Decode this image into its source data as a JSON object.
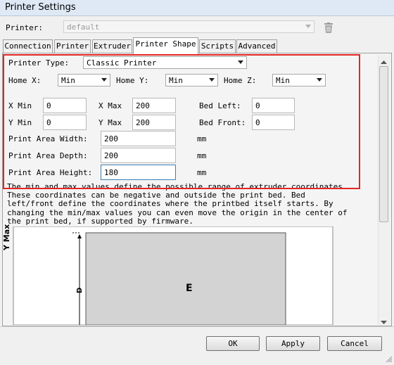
{
  "window": {
    "title": "Printer Settings"
  },
  "printer": {
    "label": "Printer:",
    "value": "default"
  },
  "tabs": [
    {
      "label": "Connection"
    },
    {
      "label": "Printer"
    },
    {
      "label": "Extruder"
    },
    {
      "label": "Printer Shape"
    },
    {
      "label": "Scripts"
    },
    {
      "label": "Advanced"
    }
  ],
  "active_tab": "Printer Shape",
  "shape": {
    "printer_type": {
      "label": "Printer Type:",
      "value": "Classic Printer"
    },
    "home_x": {
      "label": "Home X:",
      "value": "Min"
    },
    "home_y": {
      "label": "Home Y:",
      "value": "Min"
    },
    "home_z": {
      "label": "Home Z:",
      "value": "Min"
    },
    "x_min": {
      "label": "X Min",
      "value": "0"
    },
    "x_max": {
      "label": "X Max",
      "value": "200"
    },
    "bed_left": {
      "label": "Bed Left:",
      "value": "0"
    },
    "y_min": {
      "label": "Y Min",
      "value": "0"
    },
    "y_max": {
      "label": "Y Max",
      "value": "200"
    },
    "bed_front": {
      "label": "Bed Front:",
      "value": "0"
    },
    "width": {
      "label": "Print Area Width:",
      "value": "200",
      "unit": "mm"
    },
    "depth": {
      "label": "Print Area Depth:",
      "value": "200",
      "unit": "mm"
    },
    "height": {
      "label": "Print Area Height:",
      "value": "180",
      "unit": "mm"
    },
    "description": "The min and max values define the possible range of extruder coordinates.\nThese coordinates can be negative and outside the print bed. Bed\nleft/front define the coordinates where the printbed itself starts. By\nchanging the min/max values you can even move the origin in the center of\nthe print bed, if supported by firmware."
  },
  "diagram": {
    "y_axis_label": "Y Max",
    "dimension_label": "D",
    "bed_label": "E"
  },
  "buttons": {
    "ok": "OK",
    "apply": "Apply",
    "cancel": "Cancel"
  },
  "colors": {
    "highlight": "#e22626",
    "bed_fill": "#d3d3d3"
  }
}
